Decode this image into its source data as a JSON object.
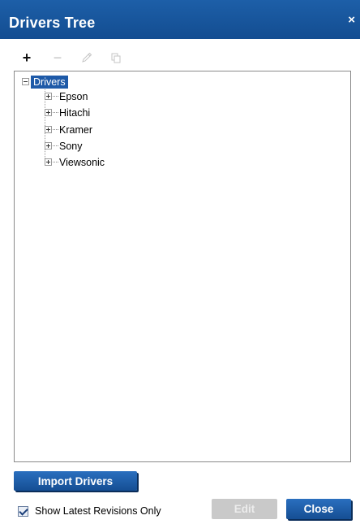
{
  "dialog": {
    "title": "Drivers Tree",
    "close_glyph": "×"
  },
  "toolbar": {
    "add_glyph": "+",
    "remove_glyph": "−",
    "edit_icon": "pencil-icon",
    "copy_icon": "copy-icon"
  },
  "tree": {
    "root": "Drivers",
    "children": [
      "Epson",
      "Hitachi",
      "Kramer",
      "Sony",
      "Viewsonic"
    ]
  },
  "buttons": {
    "import": "Import Drivers",
    "edit": "Edit",
    "close": "Close"
  },
  "options": {
    "show_latest_label": "Show Latest Revisions Only",
    "show_latest_checked": true
  },
  "colors": {
    "title_bar": "#1d5fa8",
    "accent": "#154e93",
    "selection": "#1e5aa8",
    "disabled_button": "#c9c9c9"
  }
}
